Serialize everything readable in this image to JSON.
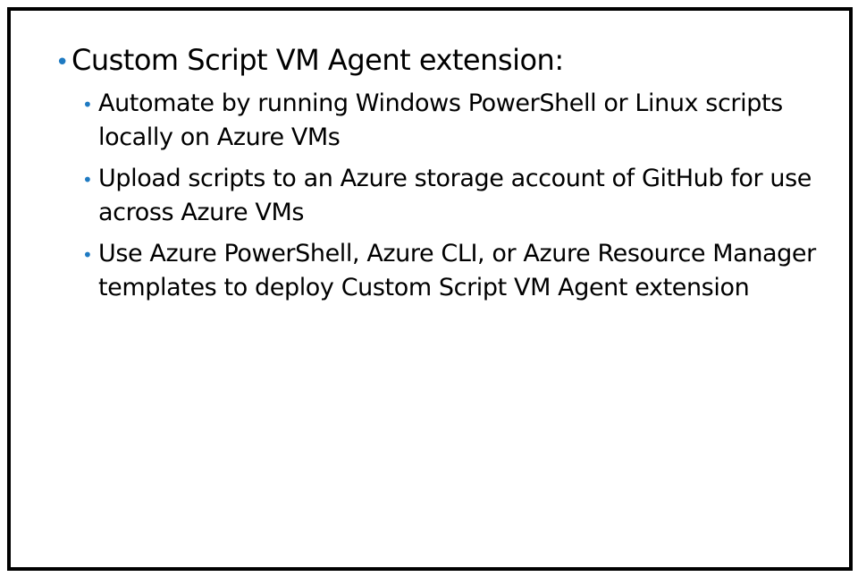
{
  "slide": {
    "bullet_color": "#1e7ac2",
    "border_color": "#000000",
    "heading": "Custom Script VM Agent extension:",
    "items": [
      "Automate by running Windows PowerShell or Linux scripts locally on Azure VMs",
      "Upload scripts to an Azure storage account of GitHub for use across Azure VMs",
      "Use Azure PowerShell, Azure CLI, or Azure Resource Manager templates to deploy Custom Script VM Agent extension"
    ]
  }
}
